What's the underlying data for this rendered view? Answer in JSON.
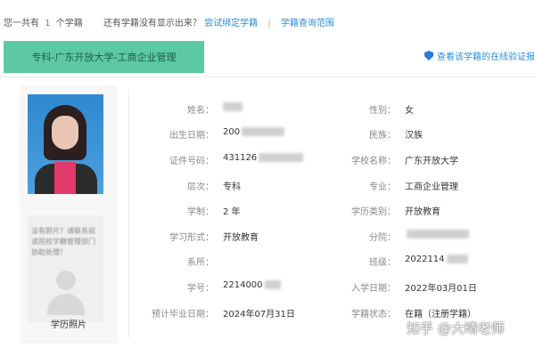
{
  "topbar": {
    "prefix": "您一共有",
    "count": "1",
    "suffix": "个学籍",
    "missing_text": "还有学籍没有显示出来？",
    "bind_link": "尝试绑定学籍",
    "separator": "|",
    "range_link": "学籍查询范围"
  },
  "tab": {
    "label": "专科-广东开放大学-工商企业管理"
  },
  "verify": {
    "label": "查看该学籍的在线验证报告"
  },
  "photo_panel": {
    "no_photo_message": "没有照片？请联系就读院校学籍管理部门协助处理！",
    "caption": "学历照片"
  },
  "fields_left": [
    {
      "label": "姓名：",
      "value": ""
    },
    {
      "label": "出生日期：",
      "value": "200"
    },
    {
      "label": "证件号码：",
      "value": "431126"
    },
    {
      "label": "层次：",
      "value": "专科"
    },
    {
      "label": "学制：",
      "value": "2 年"
    },
    {
      "label": "学习形式：",
      "value": "开放教育"
    },
    {
      "label": "系所：",
      "value": ""
    },
    {
      "label": "学号：",
      "value": "2214000"
    },
    {
      "label": "预计毕业日期：",
      "value": "2024年07月31日"
    }
  ],
  "fields_right": [
    {
      "label": "性别：",
      "value": "女"
    },
    {
      "label": "民族：",
      "value": "汉族"
    },
    {
      "label": "学校名称：",
      "value": "广东开放大学"
    },
    {
      "label": "专业：",
      "value": "工商企业管理"
    },
    {
      "label": "学历类别：",
      "value": "开放教育"
    },
    {
      "label": "分院：",
      "value": ""
    },
    {
      "label": "班级：",
      "value": "2022114"
    },
    {
      "label": "入学日期：",
      "value": "2022年03月01日"
    },
    {
      "label": "学籍状态：",
      "value": "在籍（注册学籍）"
    }
  ],
  "watermark": "知乎 @大晴老师",
  "colors": {
    "accent_green": "#5cc9a4",
    "link_blue": "#2b8fd6",
    "count_teal": "#26a69a"
  }
}
